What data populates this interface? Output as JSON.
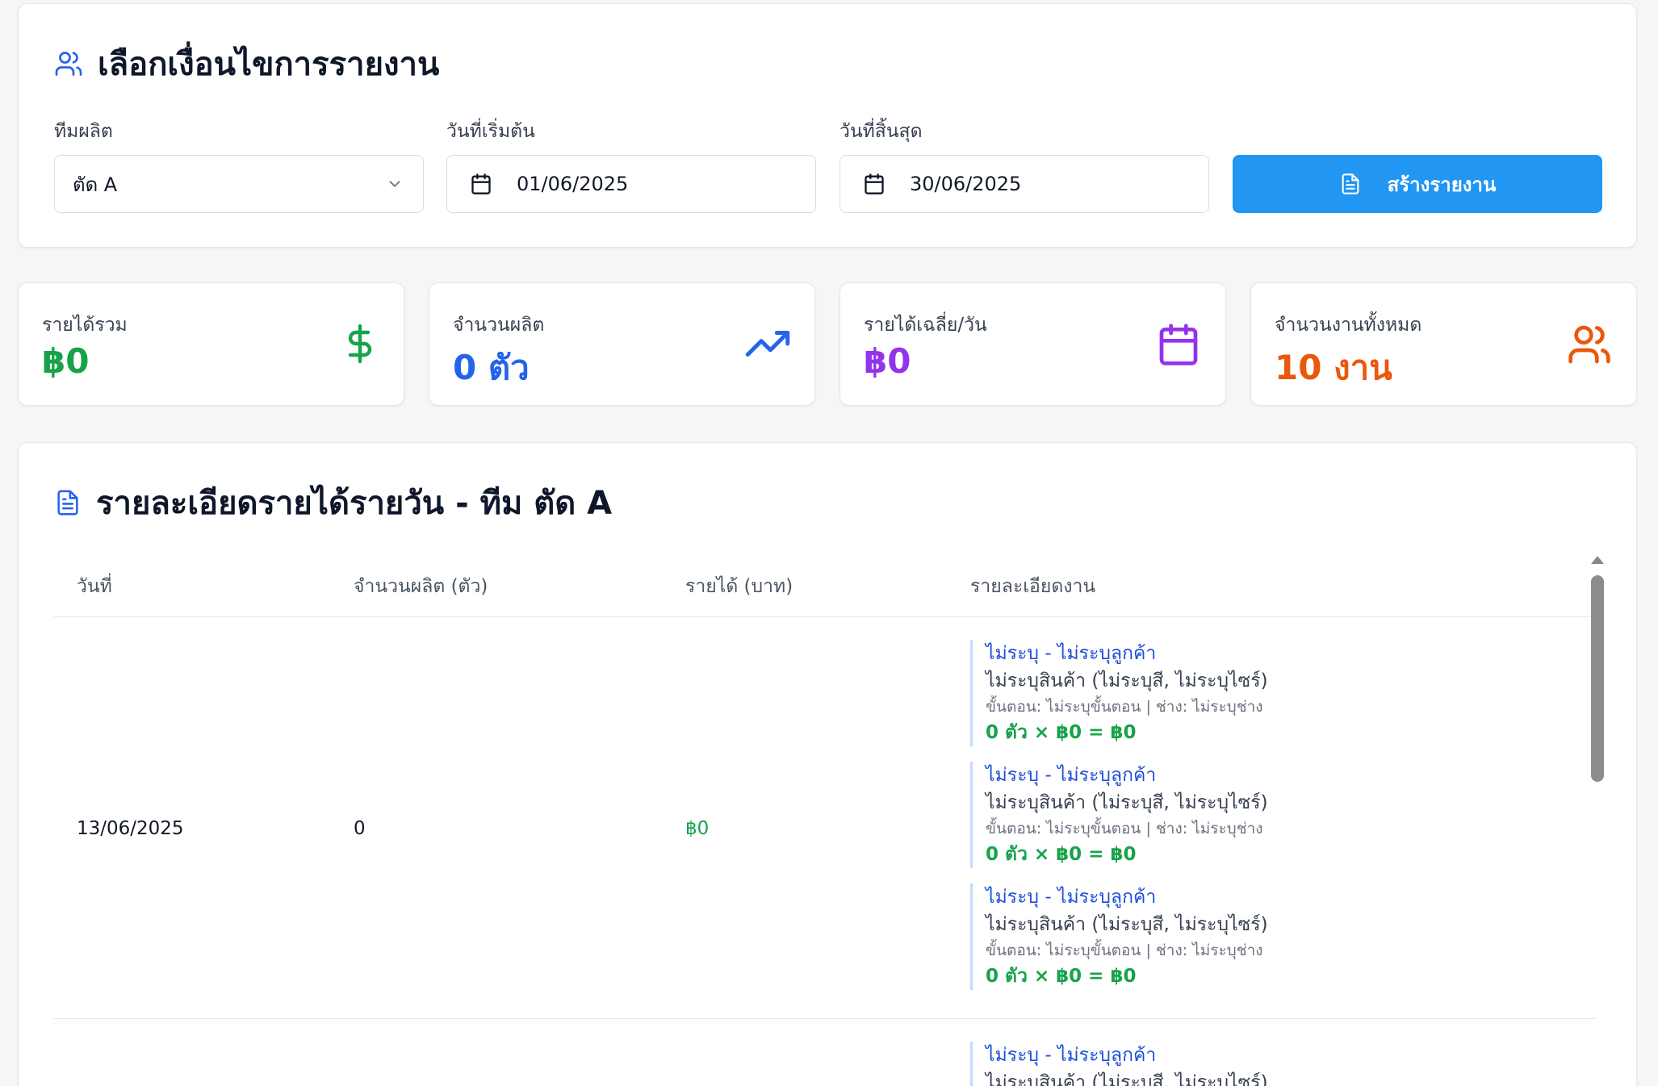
{
  "filter": {
    "title": "เลือกเงื่อนไขการรายงาน",
    "team_label": "ทีมผลิต",
    "team_value": "ตัด A",
    "start_label": "วันที่เริ่มต้น",
    "start_value": "01/06/2025",
    "end_label": "วันที่สิ้นสุด",
    "end_value": "30/06/2025",
    "create_button": "สร้างรายงาน"
  },
  "stats": [
    {
      "label": "รายได้รวม",
      "value": "฿0",
      "color": "#16a34a",
      "icon": "dollar-icon"
    },
    {
      "label": "จำนวนผลิต",
      "value": "0 ตัว",
      "color": "#2563eb",
      "icon": "trending-up-icon"
    },
    {
      "label": "รายได้เฉลี่ย/วัน",
      "value": "฿0",
      "color": "#9333ea",
      "icon": "calendar-icon"
    },
    {
      "label": "จำนวนงานทั้งหมด",
      "value": "10 งาน",
      "color": "#ea580c",
      "icon": "users-icon"
    }
  ],
  "detail": {
    "title": "รายละเอียดรายได้รายวัน - ทีม ตัด A",
    "columns": [
      "วันที่",
      "จำนวนผลิต (ตัว)",
      "รายได้ (บาท)",
      "รายละเอียดงาน"
    ],
    "rows": [
      {
        "date": "13/06/2025",
        "qty": "0",
        "income": "฿0",
        "jobs": [
          {
            "order": "ไม่ระบุ - ไม่ระบุลูกค้า",
            "product": "ไม่ระบุสินค้า (ไม่ระบุสี, ไม่ระบุไซร์)",
            "step": "ขั้นตอน: ไม่ระบุขั้นตอน | ช่าง: ไม่ระบุช่าง",
            "calc": "0 ตัว × ฿0 = ฿0"
          },
          {
            "order": "ไม่ระบุ - ไม่ระบุลูกค้า",
            "product": "ไม่ระบุสินค้า (ไม่ระบุสี, ไม่ระบุไซร์)",
            "step": "ขั้นตอน: ไม่ระบุขั้นตอน | ช่าง: ไม่ระบุช่าง",
            "calc": "0 ตัว × ฿0 = ฿0"
          },
          {
            "order": "ไม่ระบุ - ไม่ระบุลูกค้า",
            "product": "ไม่ระบุสินค้า (ไม่ระบุสี, ไม่ระบุไซร์)",
            "step": "ขั้นตอน: ไม่ระบุขั้นตอน | ช่าง: ไม่ระบุช่าง",
            "calc": "0 ตัว × ฿0 = ฿0"
          }
        ]
      },
      {
        "jobs": [
          {
            "order": "ไม่ระบุ - ไม่ระบุลูกค้า",
            "product": "ไม่ระบุสินค้า (ไม่ระบุสี, ไม่ระบุไซร์)"
          }
        ]
      }
    ]
  }
}
